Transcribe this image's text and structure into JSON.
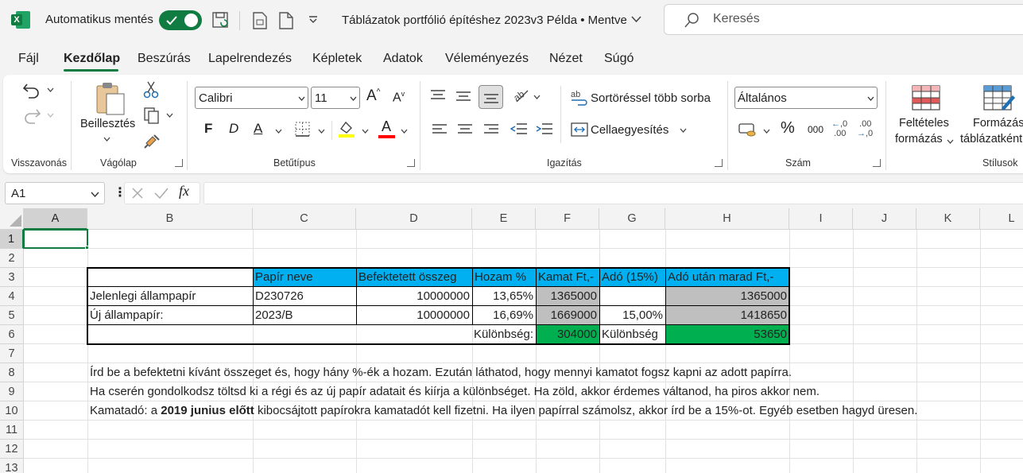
{
  "titlebar": {
    "autosave_label": "Automatikus mentés",
    "doc_title": "Táblázatok portfólió építéshez 2023v3 Példa • Mentve",
    "search_placeholder": "Keresés"
  },
  "tabs": [
    "Fájl",
    "Kezdőlap",
    "Beszúrás",
    "Lapelrendezés",
    "Képletek",
    "Adatok",
    "Véleményezés",
    "Nézet",
    "Súgó"
  ],
  "ribbon": {
    "groups": {
      "undo": "Visszavonás",
      "clipboard": "Vágólap",
      "font": "Betűtípus",
      "alignment": "Igazítás",
      "number": "Szám",
      "styles": "Stílusok"
    },
    "paste_label": "Beillesztés",
    "font_name": "Calibri",
    "font_size": "11",
    "bold": "F",
    "italic": "D",
    "underline": "A",
    "wrap_text": "Sortöréssel több sorba",
    "merge": "Cellaegyesítés",
    "number_format": "Általános",
    "percent": "%",
    "thousands": "000",
    "inc_dec": ",0\n,00",
    "conditional_1": "Feltételes",
    "conditional_2": "formázás",
    "table_1": "Formázás",
    "table_2": "táblázatként"
  },
  "formula_bar": {
    "name_box": "A1",
    "fx": "fx",
    "formula": ""
  },
  "columns": [
    "A",
    "B",
    "C",
    "D",
    "E",
    "F",
    "G",
    "H",
    "I",
    "J",
    "K",
    "L"
  ],
  "rows": [
    "1",
    "2",
    "3",
    "4",
    "5",
    "6",
    "7",
    "8",
    "9",
    "10",
    "11",
    "12",
    "13"
  ],
  "sheet": {
    "headers": {
      "paper_name": "Papír neve",
      "invested": "Befektetett összeg",
      "yield": "Hozam %",
      "interest": "Kamat Ft,-",
      "tax": "Adó (15%)",
      "after_tax": "Adó után marad Ft,-"
    },
    "row4": {
      "label": "Jelenlegi állampapír",
      "name": "D230726",
      "invested": "10000000",
      "yield": "13,65%",
      "interest": "1365000",
      "tax": "",
      "after_tax": "1365000"
    },
    "row5": {
      "label": "Új állampapír:",
      "name": "2023/B",
      "invested": "10000000",
      "yield": "16,69%",
      "interest": "1669000",
      "tax": "15,00%",
      "after_tax": "1418650"
    },
    "row6": {
      "diff_label": "Különbség:",
      "diff_interest": "304000",
      "diff_label2": "Különbség",
      "diff_after_tax": "53650"
    },
    "note8": "Írd be a befektetni kívánt összeget és, hogy hány %-ék a hozam. Ezután láthatod, hogy mennyi kamatot fogsz kapni az adott papírra.",
    "note9": "Ha cserén gondolkodsz töltsd ki a régi és az új papír adatait és kiírja a különbséget. Ha zöld, akkor érdemes váltanod, ha piros akkor nem.",
    "note10_a": "Kamatadó: a ",
    "note10_b": "2019 junius előtt",
    "note10_c": " kibocsájtott papírokra kamatadót kell fizetni. Ha ilyen papírral számolsz, akkor írd be a 15%-ot. Egyéb esetben hagyd üresen."
  },
  "colors": {
    "header_blue": "#00b0f0",
    "green": "#00b050",
    "gray": "#bfbfbf",
    "excel_green": "#107c41"
  }
}
